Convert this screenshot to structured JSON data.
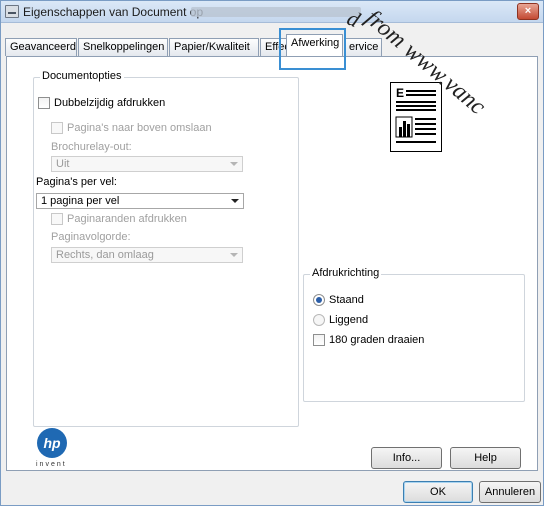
{
  "window": {
    "title": "Eigenschappen van Document op",
    "close_label": "×"
  },
  "tabs": [
    {
      "label": "Geavanceerd"
    },
    {
      "label": "Snelkoppelingen"
    },
    {
      "label": "Papier/Kwaliteit"
    },
    {
      "label": "Effecte"
    },
    {
      "label": "Afwerking"
    },
    {
      "label": "ervice"
    }
  ],
  "document_options": {
    "group_label": "Documentopties",
    "duplex_label": "Dubbelzijdig afdrukken",
    "flip_pages_label": "Pagina's naar boven omslaan",
    "booklet_layout_label": "Brochurelay-out:",
    "booklet_layout_value": "Uit",
    "pages_per_sheet_label": "Pagina's per vel:",
    "pages_per_sheet_value": "1 pagina per vel",
    "print_borders_label": "Paginaranden afdrukken",
    "page_order_label": "Paginavolgorde:",
    "page_order_value": "Rechts, dan omlaag"
  },
  "orientation": {
    "group_label": "Afdrukrichting",
    "portrait_label": "Staand",
    "landscape_label": "Liggend",
    "rotate_label": "180 graden draaien",
    "selected": "Staand"
  },
  "preview": {
    "header_letter": "E"
  },
  "brand": {
    "logo_text": "hp",
    "tagline": "invent"
  },
  "buttons": {
    "info": "Info...",
    "help": "Help",
    "ok": "OK",
    "cancel": "Annuleren"
  },
  "watermark": {
    "text": "from www.vanc",
    "prefix": "d"
  },
  "colors": {
    "tab_highlight": "#3a8fd3",
    "hp_blue": "#1f69b3"
  }
}
